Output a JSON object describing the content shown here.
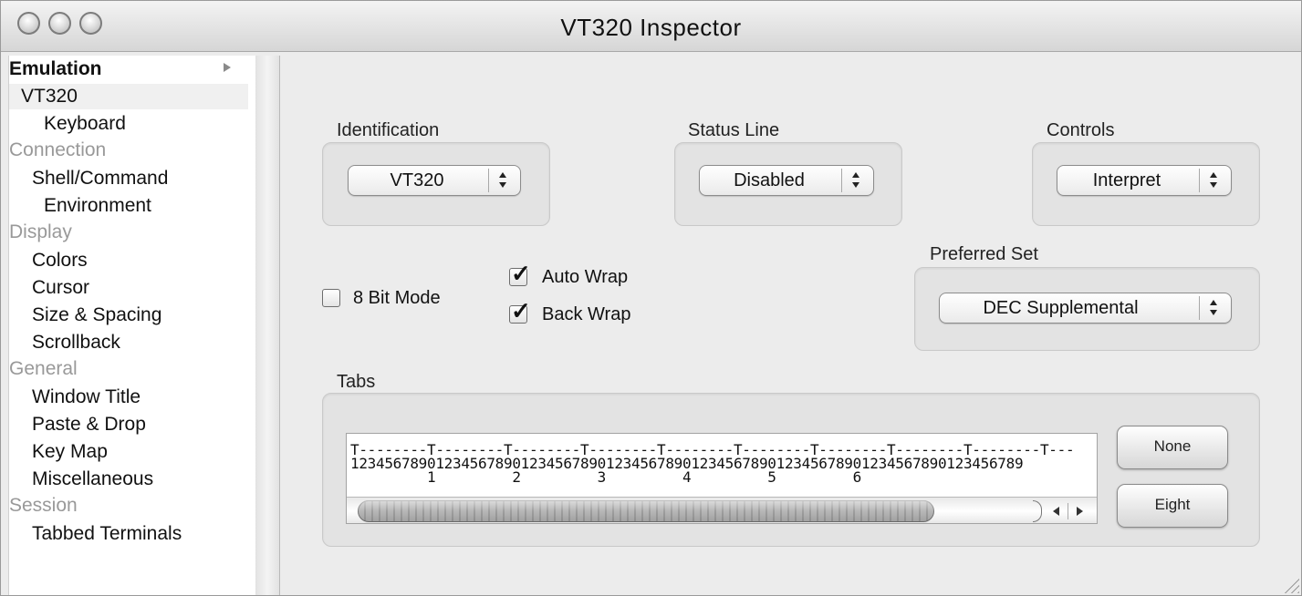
{
  "window": {
    "title": "VT320 Inspector"
  },
  "sidebar": {
    "items": [
      {
        "label": "Emulation",
        "type": "header-active"
      },
      {
        "label": "VT320",
        "type": "item",
        "selected": true
      },
      {
        "label": "Keyboard",
        "type": "subitem"
      },
      {
        "label": "Connection",
        "type": "header"
      },
      {
        "label": "Shell/Command",
        "type": "item"
      },
      {
        "label": "Environment",
        "type": "subitem"
      },
      {
        "label": "Display",
        "type": "header"
      },
      {
        "label": "Colors",
        "type": "item"
      },
      {
        "label": "Cursor",
        "type": "item"
      },
      {
        "label": "Size & Spacing",
        "type": "item"
      },
      {
        "label": "Scrollback",
        "type": "item"
      },
      {
        "label": "General",
        "type": "header"
      },
      {
        "label": "Window Title",
        "type": "item"
      },
      {
        "label": "Paste & Drop",
        "type": "item"
      },
      {
        "label": "Key Map",
        "type": "item"
      },
      {
        "label": "Miscellaneous",
        "type": "item"
      },
      {
        "label": "Session",
        "type": "header"
      },
      {
        "label": "Tabbed Terminals",
        "type": "item"
      }
    ]
  },
  "identification": {
    "label": "Identification",
    "value": "VT320"
  },
  "status_line": {
    "label": "Status Line",
    "value": "Disabled"
  },
  "controls": {
    "label": "Controls",
    "value": "Interpret"
  },
  "preferred_set": {
    "label": "Preferred Set",
    "value": "DEC Supplemental"
  },
  "options": {
    "eight_bit_mode": {
      "label": "8 Bit Mode",
      "checked": false
    },
    "auto_wrap": {
      "label": "Auto Wrap",
      "checked": true
    },
    "back_wrap": {
      "label": "Back Wrap",
      "checked": true
    }
  },
  "tabs": {
    "label": "Tabs",
    "ruler_line1": "T--------T--------T--------T--------T--------T--------T--------T--------T--------T---",
    "ruler_line2": "1234567890123456789012345678901234567890123456789012345678901234567890123456789",
    "ruler_line3": "         1         2         3         4         5         6",
    "none_button": "None",
    "eight_button": "Eight"
  }
}
